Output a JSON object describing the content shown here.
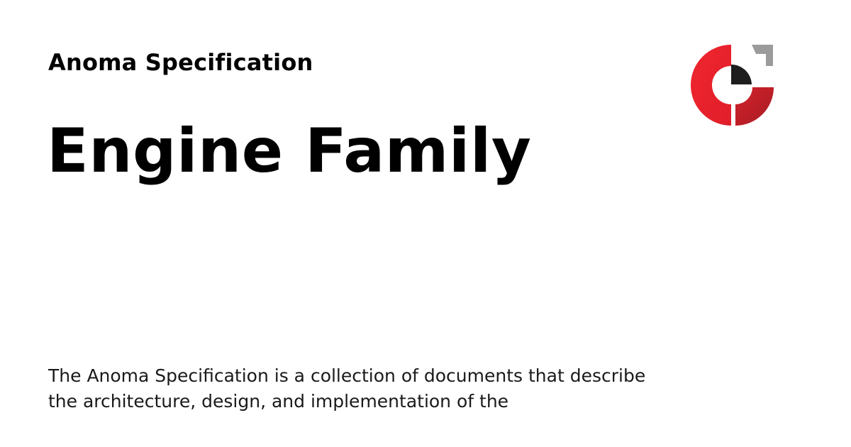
{
  "site": {
    "name": "Anoma Specification"
  },
  "page": {
    "title": "Engine Family",
    "description": "The Anoma Specification is a collection of documents that describe the architecture, design, and implementation of the"
  },
  "logo": {
    "icon": "anoma-logo-icon",
    "colors": {
      "red": "#E8242F",
      "dark_red": "#B81E27",
      "gray": "#9B9B9B",
      "black": "#1E1E1E"
    }
  }
}
